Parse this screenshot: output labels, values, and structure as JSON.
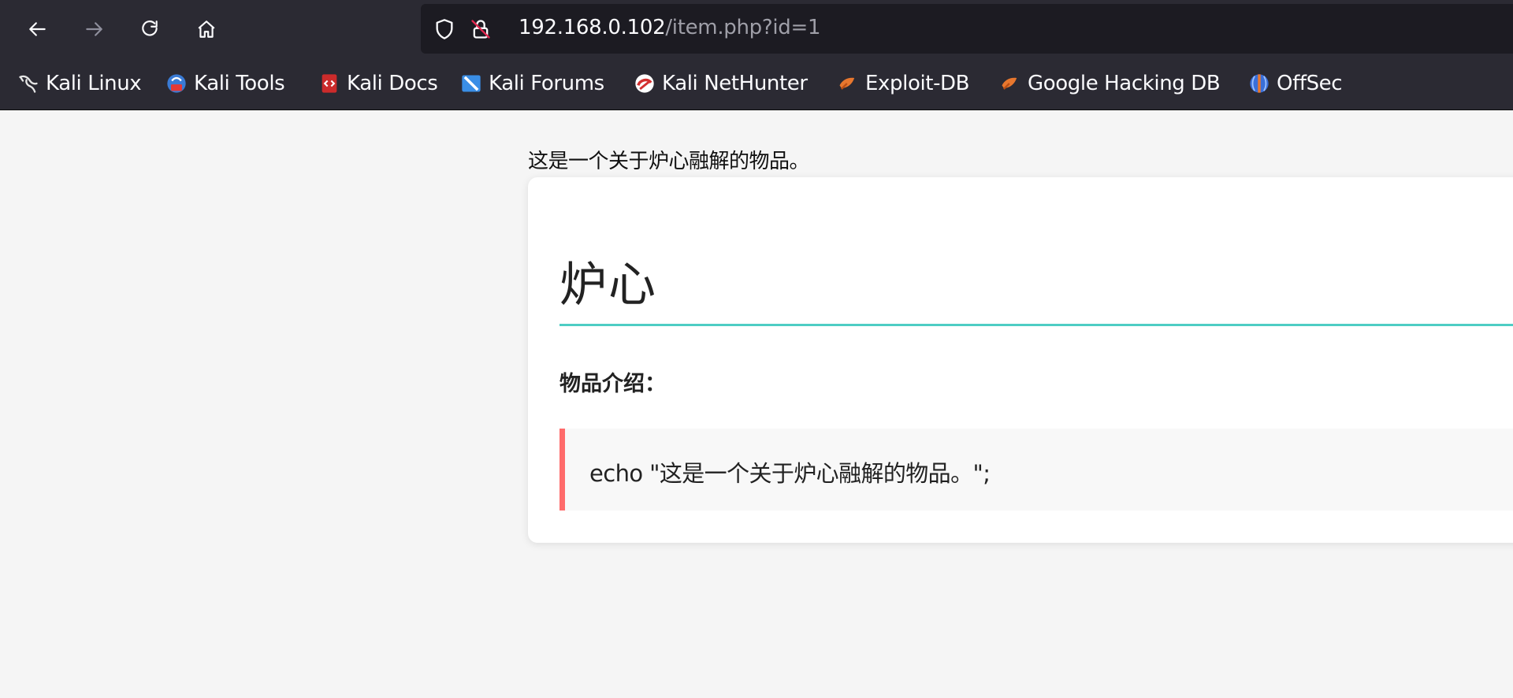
{
  "browser": {
    "nav": {
      "back_icon": "arrow-left-icon",
      "forward_icon": "arrow-right-icon",
      "reload_icon": "reload-icon",
      "home_icon": "home-icon"
    },
    "url": {
      "host": "192.168.0.102",
      "path": "/item.php?id=1",
      "shield_icon": "shield-icon",
      "insecure_icon": "insecure-lock-icon"
    },
    "bookmarks": [
      {
        "label": "Kali Linux",
        "icon": "kali-dragon-icon",
        "color": "#e6e6e6"
      },
      {
        "label": "Kali Tools",
        "icon": "kali-tools-icon",
        "color": "#3a7bd5"
      },
      {
        "label": "Kali Docs",
        "icon": "kali-docs-icon",
        "color": "#cc2b2b"
      },
      {
        "label": "Kali Forums",
        "icon": "kali-forums-icon",
        "color": "#3a8ee6"
      },
      {
        "label": "Kali NetHunter",
        "icon": "kali-nethunter-icon",
        "color": "#d32f2f"
      },
      {
        "label": "Exploit-DB",
        "icon": "exploit-db-icon",
        "color": "#e8772e"
      },
      {
        "label": "Google Hacking DB",
        "icon": "google-hacking-db-icon",
        "color": "#e8772e"
      },
      {
        "label": "OffSec",
        "icon": "offsec-icon",
        "color": "#3a6fd8"
      }
    ]
  },
  "page": {
    "lead_text": "这是一个关于炉心融解的物品。",
    "item_title": "炉心",
    "intro_label": "物品介绍：",
    "code_text": "echo \"这是一个关于炉心融解的物品。\";",
    "accent_color": "#4ecdc4",
    "code_border_color": "#ff6b6b"
  }
}
